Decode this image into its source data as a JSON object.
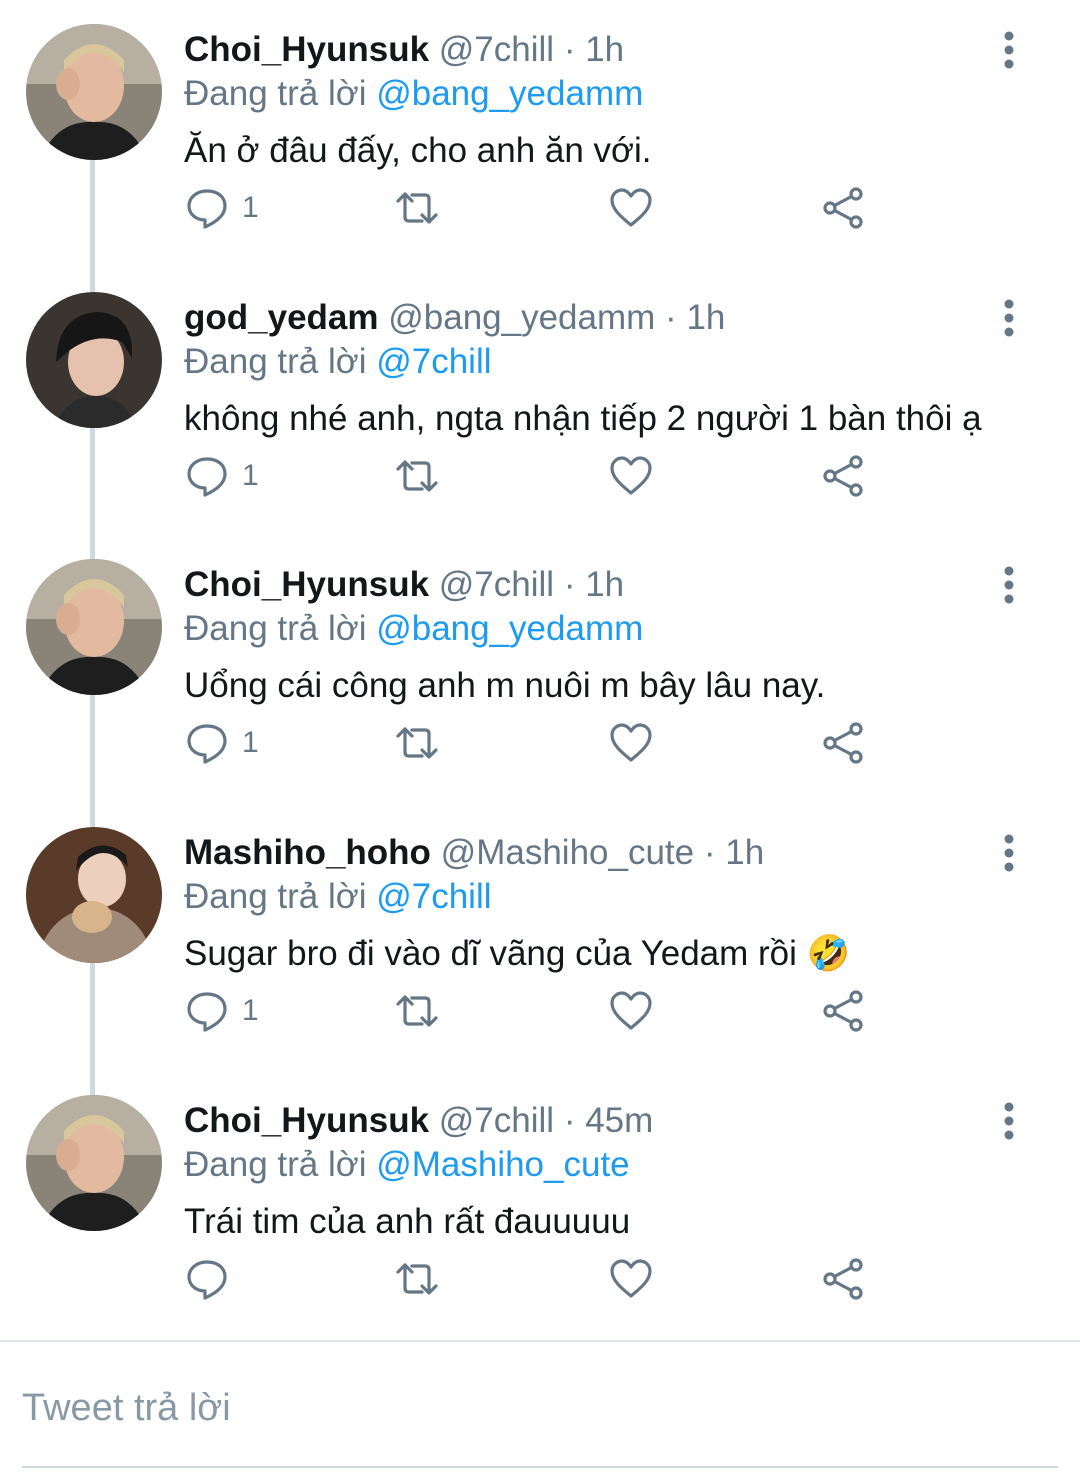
{
  "tweets": [
    {
      "avatar_icon": "avatar-photo",
      "name": "Choi_Hyunsuk",
      "handle": "@7chill",
      "separator": "·",
      "time": "1h",
      "replying_prefix": "Đang trả lời",
      "replying_to": "@bang_yedamm",
      "text": "Ăn ở đâu đấy, cho anh ăn với.",
      "reply_count": "1"
    },
    {
      "avatar_icon": "avatar-photo",
      "name": "god_yedam",
      "handle": "@bang_yedamm",
      "separator": "·",
      "time": "1h",
      "replying_prefix": "Đang trả lời",
      "replying_to": "@7chill",
      "text": "không nhé anh, ngta nhận tiếp 2 người 1 bàn thôi ạ",
      "reply_count": "1"
    },
    {
      "avatar_icon": "avatar-photo",
      "name": "Choi_Hyunsuk",
      "handle": "@7chill",
      "separator": "·",
      "time": "1h",
      "replying_prefix": "Đang trả lời",
      "replying_to": "@bang_yedamm",
      "text": "Uổng cái công anh m nuôi m bây lâu nay.",
      "reply_count": "1"
    },
    {
      "avatar_icon": "avatar-photo",
      "name": "Mashiho_hoho",
      "handle": "@Mashiho_cute",
      "separator": "·",
      "time": "1h",
      "replying_prefix": "Đang trả lời",
      "replying_to": "@7chill",
      "text": "Sugar bro đi vào dĩ vãng của Yedam rồi 🤣",
      "reply_count": "1"
    },
    {
      "avatar_icon": "avatar-photo",
      "name": "Choi_Hyunsuk",
      "handle": "@7chill",
      "separator": "·",
      "time": "45m",
      "replying_prefix": "Đang trả lời",
      "replying_to": "@Mashiho_cute",
      "text": "Trái tim của anh rất đauuuuu",
      "reply_count": ""
    }
  ],
  "composer": {
    "placeholder": "Tweet trả lời"
  },
  "colors": {
    "mention": "#1d9bf0",
    "secondary_text": "#657786",
    "icon": "#657786",
    "thread_line": "#cfd9de"
  }
}
